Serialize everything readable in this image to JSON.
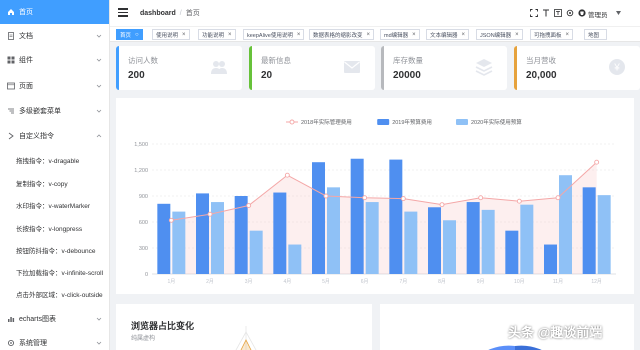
{
  "colors": {
    "accent": "#409eff",
    "sidebar_bg": "#ffffff",
    "stripe_blue": "#409eff",
    "stripe_green": "#67c23a",
    "stripe_gray": "#b7b9bd",
    "stripe_yellow": "#e6a23c",
    "bar_2019": "#4f8ff0",
    "bar_2020": "#8fc1f6",
    "line_2018": "#f4a7a7"
  },
  "sidebar": {
    "items": [
      {
        "label": "首页",
        "icon": "home-icon",
        "active": true,
        "arrow": false
      },
      {
        "label": "文档",
        "icon": "document-icon",
        "arrow": true
      },
      {
        "label": "组件",
        "icon": "component-icon",
        "arrow": true
      },
      {
        "label": "页面",
        "icon": "page-icon",
        "arrow": true
      },
      {
        "label": "多级嵌套菜单",
        "icon": "nested-menu-icon",
        "arrow": true
      },
      {
        "label": "自定义指令",
        "icon": "directive-icon",
        "arrow": true,
        "open": true
      }
    ],
    "sub_items": [
      {
        "label": "拖拽指令：v-dragable"
      },
      {
        "label": "复制指令：v-copy"
      },
      {
        "label": "水印指令：v-waterMarker"
      },
      {
        "label": "长按指令：v-longpress"
      },
      {
        "label": "按钮防抖指令：v-debounce"
      },
      {
        "label": "下拉加载指令：v-infinite-scroll"
      },
      {
        "label": "点击外部区域：v-click-outside"
      }
    ],
    "bottom_items": [
      {
        "label": "echarts图表",
        "icon": "chart-icon",
        "arrow": true
      },
      {
        "label": "系统管理",
        "icon": "system-icon",
        "arrow": true
      }
    ]
  },
  "header": {
    "breadcrumb": [
      "dashboard",
      "首页"
    ],
    "separator": "/",
    "user": "管理员",
    "icons": [
      "fullscreen-icon",
      "font-size-icon",
      "language-icon",
      "settings-icon",
      "github-icon"
    ]
  },
  "tags": [
    {
      "label": "首页",
      "active": true,
      "close": "○"
    },
    {
      "label": "使用说明",
      "close": "×"
    },
    {
      "label": "功能说明",
      "close": "×"
    },
    {
      "label": "keepAlive使用说明",
      "close": "×"
    },
    {
      "label": "数据表格的缩影改变",
      "close": "×"
    },
    {
      "label": "md编辑器",
      "close": "×"
    },
    {
      "label": "文本编辑器",
      "close": "×"
    },
    {
      "label": "JSON编辑器",
      "close": "×"
    },
    {
      "label": "可拖拽面板",
      "close": "×"
    },
    {
      "label": "地图",
      "close": ""
    }
  ],
  "stats": [
    {
      "title": "访问人数",
      "value": "200",
      "icon": "visitors-icon"
    },
    {
      "title": "最新信息",
      "value": "20",
      "icon": "message-icon"
    },
    {
      "title": "库存数量",
      "value": "20000",
      "icon": "stack-icon"
    },
    {
      "title": "当月营收",
      "value": "20,000",
      "icon": "revenue-icon"
    }
  ],
  "chart_data": {
    "type": "bar",
    "legend_position": "top-center",
    "grid": true,
    "ylim": [
      0,
      1500
    ],
    "yticks": [
      "0",
      "300",
      "600",
      "900",
      "1,200",
      "1,500"
    ],
    "categories": [
      "1月",
      "2月",
      "3月",
      "4月",
      "5月",
      "6月",
      "7月",
      "8月",
      "9月",
      "10月",
      "11月",
      "12月"
    ],
    "series": [
      {
        "name": "2018年实际管理费用",
        "kind": "line",
        "values": [
          620,
          690,
          790,
          1140,
          900,
          880,
          870,
          800,
          880,
          840,
          880,
          1290
        ]
      },
      {
        "name": "2019年预算费用",
        "kind": "bar",
        "values": [
          810,
          930,
          900,
          940,
          1290,
          1330,
          1320,
          770,
          830,
          500,
          340,
          1000
        ]
      },
      {
        "name": "2020年实际使用预算",
        "kind": "bar",
        "values": [
          720,
          830,
          500,
          340,
          1000,
          830,
          720,
          620,
          740,
          800,
          1140,
          910
        ]
      }
    ]
  },
  "bottom_left": {
    "title": "浏览器占比变化",
    "subtitle": "纯属虚构"
  },
  "watermark": "头条 @趣谈前端"
}
